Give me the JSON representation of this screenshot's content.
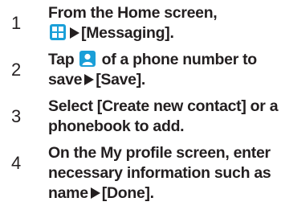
{
  "steps": [
    {
      "number": "1",
      "lines": [
        "From the Home screen,",
        "[Messaging]."
      ]
    },
    {
      "number": "2",
      "pre": "Tap",
      "post": "of a phone number to",
      "line2_a": "save",
      "line2_b": "[Save]."
    },
    {
      "number": "3",
      "lines": [
        "Select [Create new contact] or a",
        "phonebook to add."
      ]
    },
    {
      "number": "4",
      "lines": [
        "On the My profile screen, enter",
        "necessary information such as",
        "name",
        "[Done]."
      ]
    }
  ],
  "icons": {
    "apps": "apps-grid-icon",
    "contact": "contact-person-icon",
    "arrow": "right-triangle-icon"
  },
  "colors": {
    "text": "#231f20",
    "apps_icon": "#1a9fd8",
    "contact_icon": "#1a9fd8"
  }
}
